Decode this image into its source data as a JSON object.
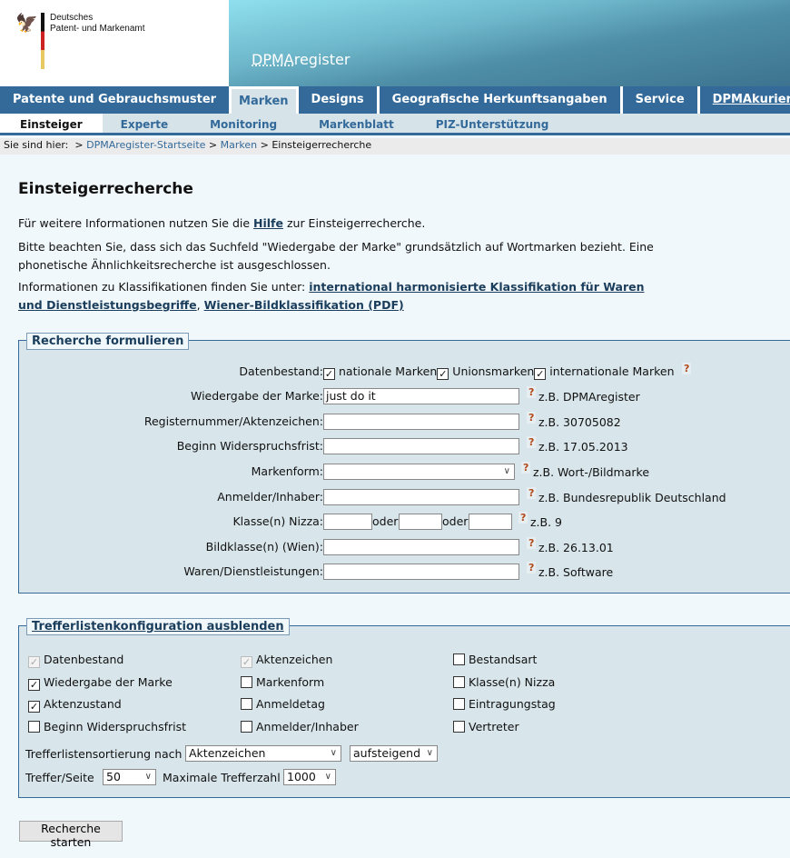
{
  "header": {
    "org_line1": "Deutsches",
    "org_line2": "Patent- und Markenamt",
    "app_title_underlined": "DPMA",
    "app_title_rest": "register"
  },
  "nav": {
    "items": [
      "Patente und Gebrauchsmuster",
      "Marken",
      "Designs",
      "Geografische Herkunftsangaben",
      "Service",
      "DPMAkurier"
    ],
    "active": "Marken"
  },
  "subnav": {
    "items": [
      "Einsteiger",
      "Experte",
      "Monitoring",
      "Markenblatt",
      "PIZ-Unterstützung"
    ],
    "active": "Einsteiger"
  },
  "breadcrumb": {
    "prefix": "Sie sind hier:",
    "sep": ">",
    "items": [
      "DPMAregister-Startseite",
      "Marken",
      "Einsteigerrecherche"
    ]
  },
  "page": {
    "title": "Einsteigerrecherche",
    "p1_a": "Für weitere Informationen nutzen Sie die ",
    "p1_link": "Hilfe",
    "p1_b": " zur Einsteigerrecherche.",
    "p2": "Bitte beachten Sie, dass sich das Suchfeld \"Wiedergabe der Marke\" grundsätzlich auf Wortmarken bezieht. Eine phonetische Ähnlichkeitsrecherche ist ausgeschlossen.",
    "p3_a": "Informationen zu Klassifikationen finden Sie unter: ",
    "p3_link1": "international harmonisierte Klassifikation für Waren und Dienstleistungsbegriffe",
    "p3_sep": ", ",
    "p3_link2": "Wiener-Bildklassifikation (PDF)"
  },
  "search": {
    "legend": "Recherche formulieren",
    "datenbestand_label": "Datenbestand:",
    "datenbestand": [
      {
        "label": "nationale Marken",
        "checked": true
      },
      {
        "label": "Unionsmarken",
        "checked": true
      },
      {
        "label": "internationale Marken",
        "checked": true
      }
    ],
    "help": "?",
    "fields": [
      {
        "label": "Wiedergabe der Marke:",
        "value": "just do it",
        "example": "z.B. DPMAregister"
      },
      {
        "label": "Registernummer/Aktenzeichen:",
        "value": "",
        "example": "z.B. 30705082"
      },
      {
        "label": "Beginn Widerspruchsfrist:",
        "value": "",
        "example": "z.B. 17.05.2013"
      },
      {
        "label": "Markenform:",
        "value": "",
        "example": "z.B. Wort-/Bildmarke"
      },
      {
        "label": "Anmelder/Inhaber:",
        "value": "",
        "example": "z.B. Bundesrepublik Deutschland"
      },
      {
        "label": "Klasse(n) Nizza:",
        "value": "",
        "example": "z.B. 9",
        "or": "oder"
      },
      {
        "label": "Bildklasse(n) (Wien):",
        "value": "",
        "example": "z.B. 26.13.01"
      },
      {
        "label": "Waren/Dienstleistungen:",
        "value": "",
        "example": "z.B. Software"
      }
    ]
  },
  "config": {
    "legend": "Trefferlistenkonfiguration ausblenden",
    "columns": [
      {
        "label": "Datenbestand",
        "checked": true,
        "disabled": true
      },
      {
        "label": "Aktenzeichen",
        "checked": true,
        "disabled": true
      },
      {
        "label": "Bestandsart",
        "checked": false
      },
      {
        "label": "Wiedergabe der Marke",
        "checked": true
      },
      {
        "label": "Markenform",
        "checked": false
      },
      {
        "label": "Klasse(n) Nizza",
        "checked": false
      },
      {
        "label": "Aktenzustand",
        "checked": true
      },
      {
        "label": "Anmeldetag",
        "checked": false
      },
      {
        "label": "Eintragungstag",
        "checked": false
      },
      {
        "label": "Beginn Widerspruchsfrist",
        "checked": false
      },
      {
        "label": "Anmelder/Inhaber",
        "checked": false
      },
      {
        "label": "Vertreter",
        "checked": false
      }
    ],
    "sort_label": "Trefferlistensortierung nach",
    "sort_value": "Aktenzeichen",
    "order_value": "aufsteigend",
    "per_page_label": "Treffer/Seite",
    "per_page_value": "50",
    "max_label": "Maximale Trefferzahl",
    "max_value": "1000"
  },
  "submit_label": "Recherche starten",
  "colors": {
    "nav": "#336a9a",
    "fieldset": "#d8e5ea",
    "page": "#f1f8fb"
  }
}
